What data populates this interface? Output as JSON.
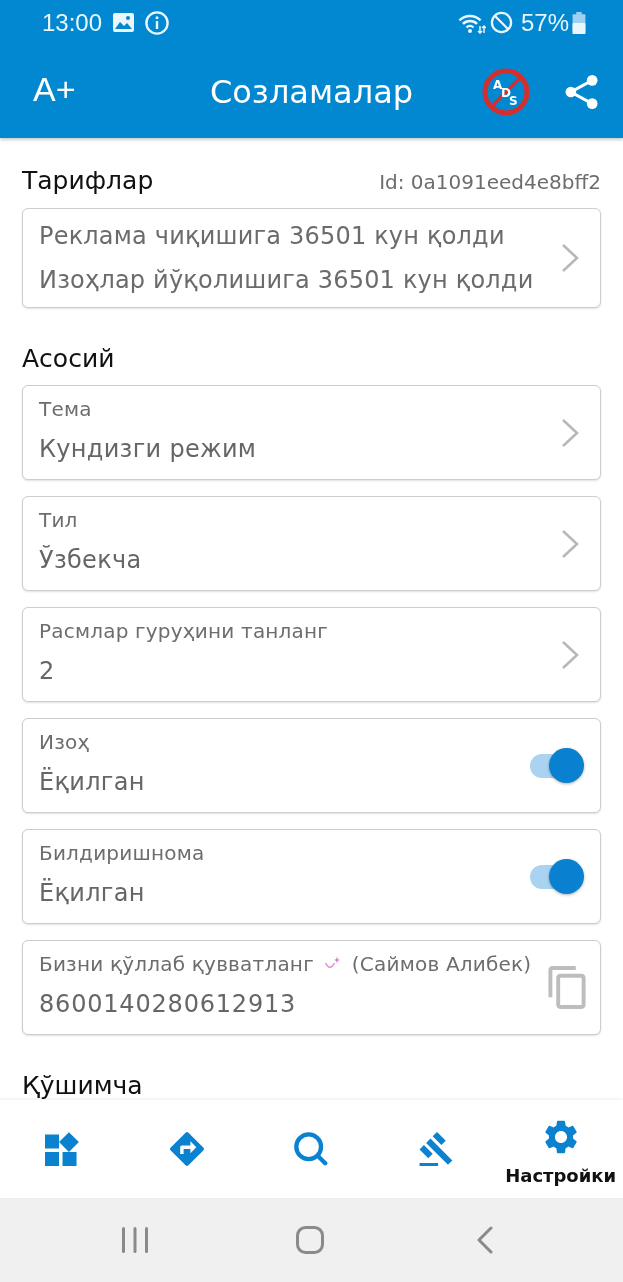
{
  "status_bar": {
    "time": "13:00",
    "battery": "57%"
  },
  "app_bar": {
    "font_button": "A+",
    "title": "Созламалар",
    "no_ads_letters": [
      "A",
      "D",
      "S"
    ]
  },
  "sections": [
    {
      "title": "Тарифлар",
      "id_text": "Id: 0a1091eed4e8bff2",
      "cards": [
        {
          "kind": "info",
          "lines": [
            "Реклама чиқишига 36501 кун қолди",
            "Изоҳлар йўқолишига 36501 кун қолди"
          ]
        }
      ]
    },
    {
      "title": "Асосий",
      "cards": [
        {
          "kind": "nav",
          "label": "Тема",
          "value": "Кундизги режим"
        },
        {
          "kind": "nav",
          "label": "Тил",
          "value": "Ўзбекча"
        },
        {
          "kind": "nav",
          "label": "Расмлар гуруҳини танланг",
          "value": "2"
        },
        {
          "kind": "toggle",
          "label": "Изоҳ",
          "value": "Ёқилган",
          "on": true
        },
        {
          "kind": "toggle",
          "label": "Билдиришнома",
          "value": "Ёқилган",
          "on": true
        },
        {
          "kind": "copy",
          "label": "Бизни қўллаб қувватланг",
          "note": "(Саймов Алибек)",
          "value": "8600140280612913"
        }
      ]
    },
    {
      "title": "Қўшимча"
    }
  ],
  "bottom_nav": {
    "items": [
      {
        "selected": false
      },
      {
        "selected": false
      },
      {
        "selected": false
      },
      {
        "selected": false
      },
      {
        "selected": true,
        "label": "Настройки"
      }
    ]
  }
}
